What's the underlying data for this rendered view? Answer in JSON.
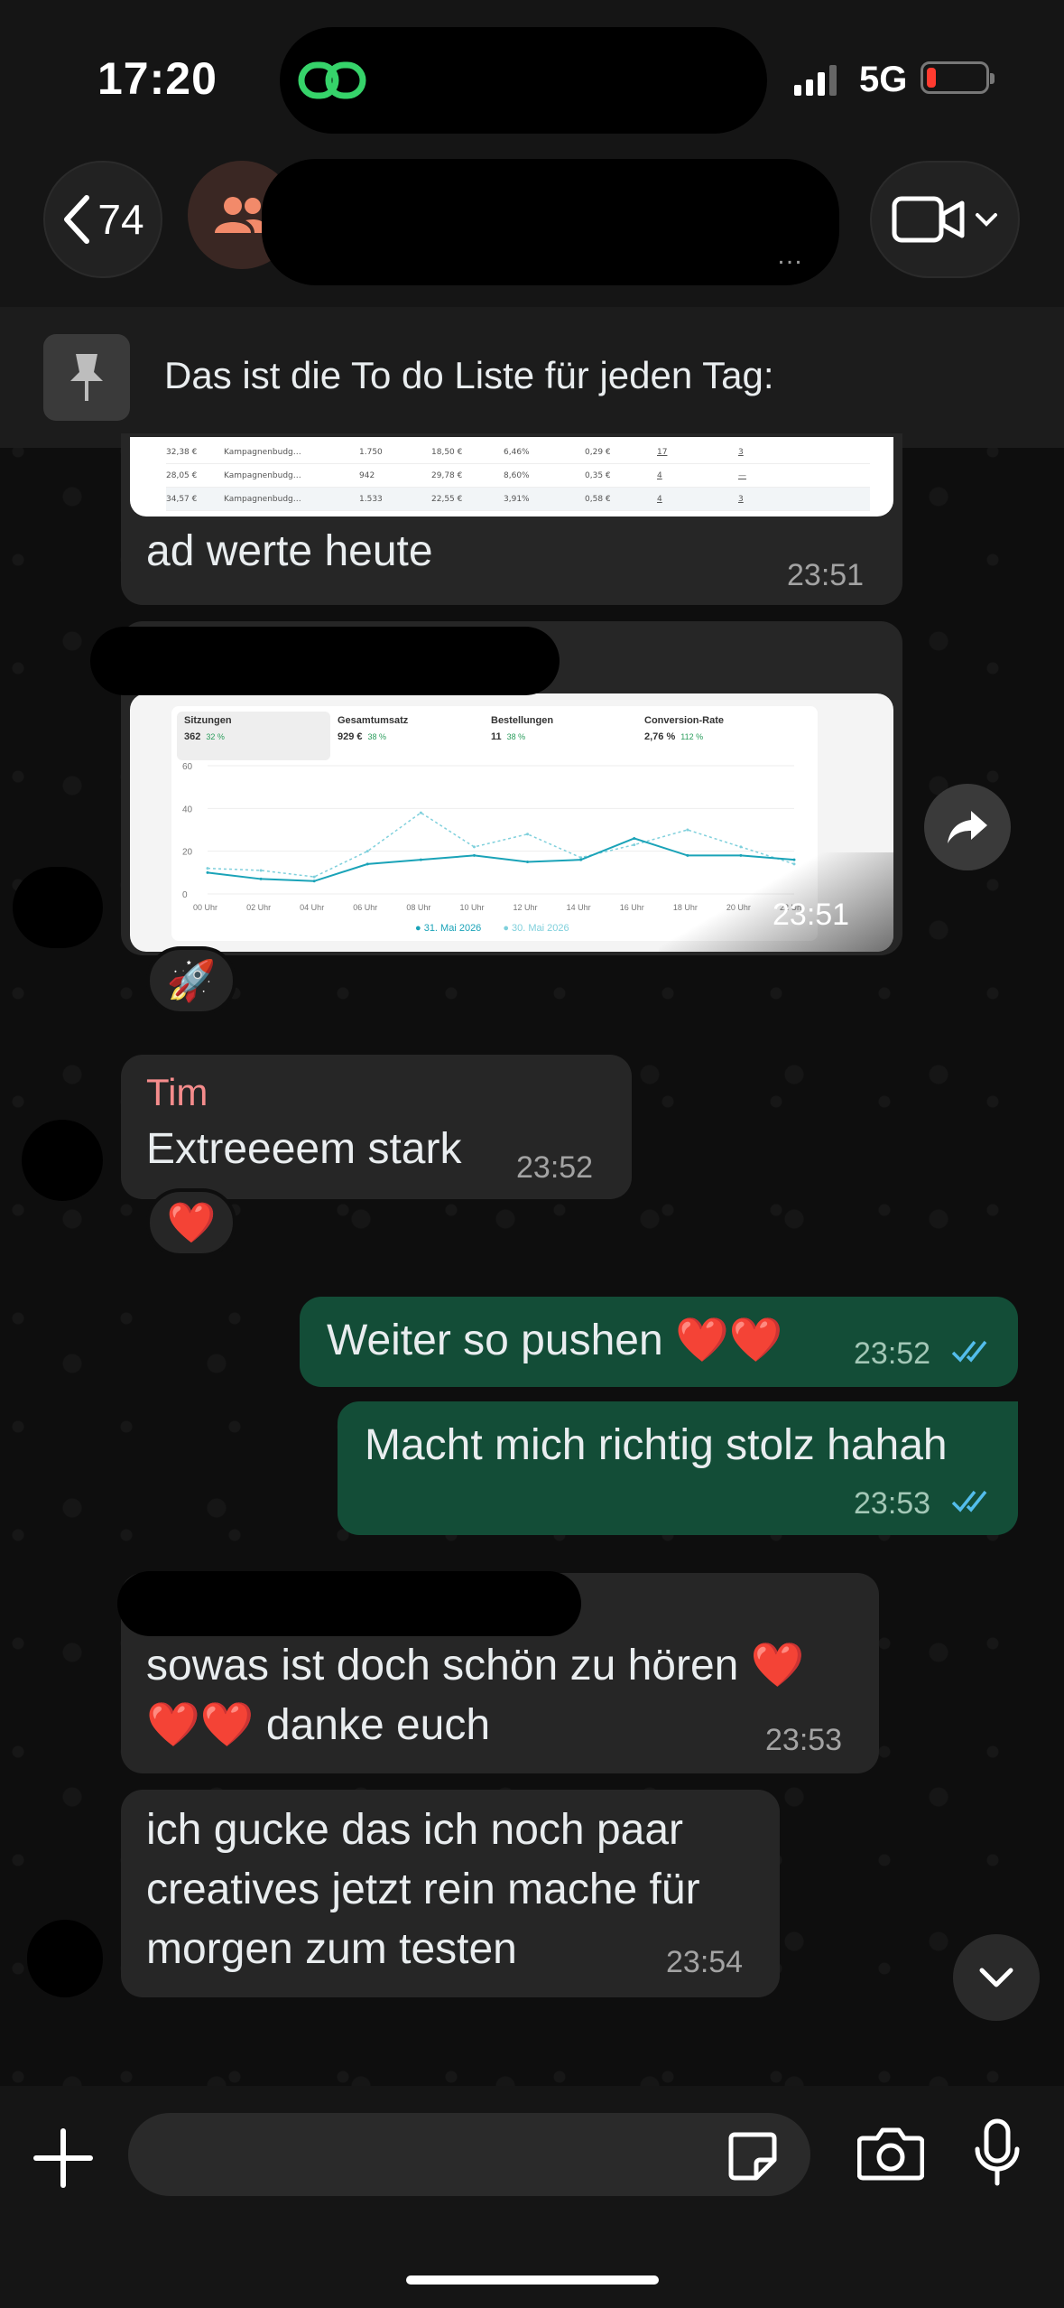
{
  "status": {
    "time": "17:20",
    "network": "5G",
    "colors": {
      "battery_low": "#ff3b30"
    }
  },
  "header": {
    "back_count": "74",
    "subtitle_ellipsis": "…",
    "icons": [
      "chevron-left-icon",
      "group-icon",
      "video-camera-icon",
      "chevron-down-icon"
    ]
  },
  "pinned": {
    "text": "Das ist die To do Liste für jeden Tag:"
  },
  "table_rows": [
    [
      "32,38 €",
      "Kampagnenbudg…",
      "1.750",
      "18,50 €",
      "6,46%",
      "0,29 €",
      "17",
      "3"
    ],
    [
      "28,05 €",
      "Kampagnenbudg…",
      "942",
      "29,78 €",
      "8,60%",
      "0,35 €",
      "4",
      "—"
    ],
    [
      "34,57 €",
      "Kampagnenbudg…",
      "1.533",
      "22,55 €",
      "3,91%",
      "0,58 €",
      "4",
      "3"
    ]
  ],
  "messages": [
    {
      "text": "ad werte heute",
      "time": "23:51"
    },
    {
      "time": "23:51",
      "reaction": "🚀"
    },
    {
      "sender": "Tim",
      "text": "Extreeeem stark",
      "time": "23:52",
      "reaction": "❤️"
    },
    {
      "text": "Weiter so pushen ❤️❤️",
      "time": "23:52"
    },
    {
      "text": "Macht mich richtig stolz hahah",
      "time": "23:53"
    },
    {
      "text_line1": "sowas ist doch schön zu hören ❤️",
      "text_line2": "❤️❤️ danke euch",
      "time": "23:53"
    },
    {
      "text_line1": "ich gucke das ich noch paar",
      "text_line2": "creatives jetzt rein mache für",
      "text_line3": "morgen zum testen",
      "time": "23:54"
    }
  ],
  "analytics": {
    "metrics": [
      {
        "label": "Sitzungen",
        "value": "362",
        "change": "32 %"
      },
      {
        "label": "Gesamtumsatz",
        "value": "929 €",
        "change": "38 %"
      },
      {
        "label": "Bestellungen",
        "value": "11",
        "change": "38 %"
      },
      {
        "label": "Conversion-Rate",
        "value": "2,76 %",
        "change": "112 %"
      }
    ],
    "legend": [
      "31. Mai 2026",
      "30. Mai 2026"
    ]
  },
  "chart_data": {
    "type": "line",
    "x": [
      "00 Uhr",
      "02 Uhr",
      "04 Uhr",
      "06 Uhr",
      "08 Uhr",
      "10 Uhr",
      "12 Uhr",
      "14 Uhr",
      "16 Uhr",
      "18 Uhr",
      "20 Uhr",
      "22 Uhr"
    ],
    "ylim": [
      0,
      60
    ],
    "yticks": [
      "60",
      "40",
      "20",
      "0"
    ],
    "series": [
      {
        "name": "31. Mai 2026",
        "values": [
          10,
          7,
          6,
          14,
          16,
          18,
          15,
          16,
          26,
          18,
          18,
          16
        ],
        "color": "#1aa3b8"
      },
      {
        "name": "30. Mai 2026",
        "values": [
          12,
          11,
          8,
          20,
          38,
          22,
          28,
          17,
          23,
          30,
          22,
          14
        ],
        "color": "#7fd0dc"
      }
    ]
  },
  "composer": {
    "placeholder": ""
  }
}
